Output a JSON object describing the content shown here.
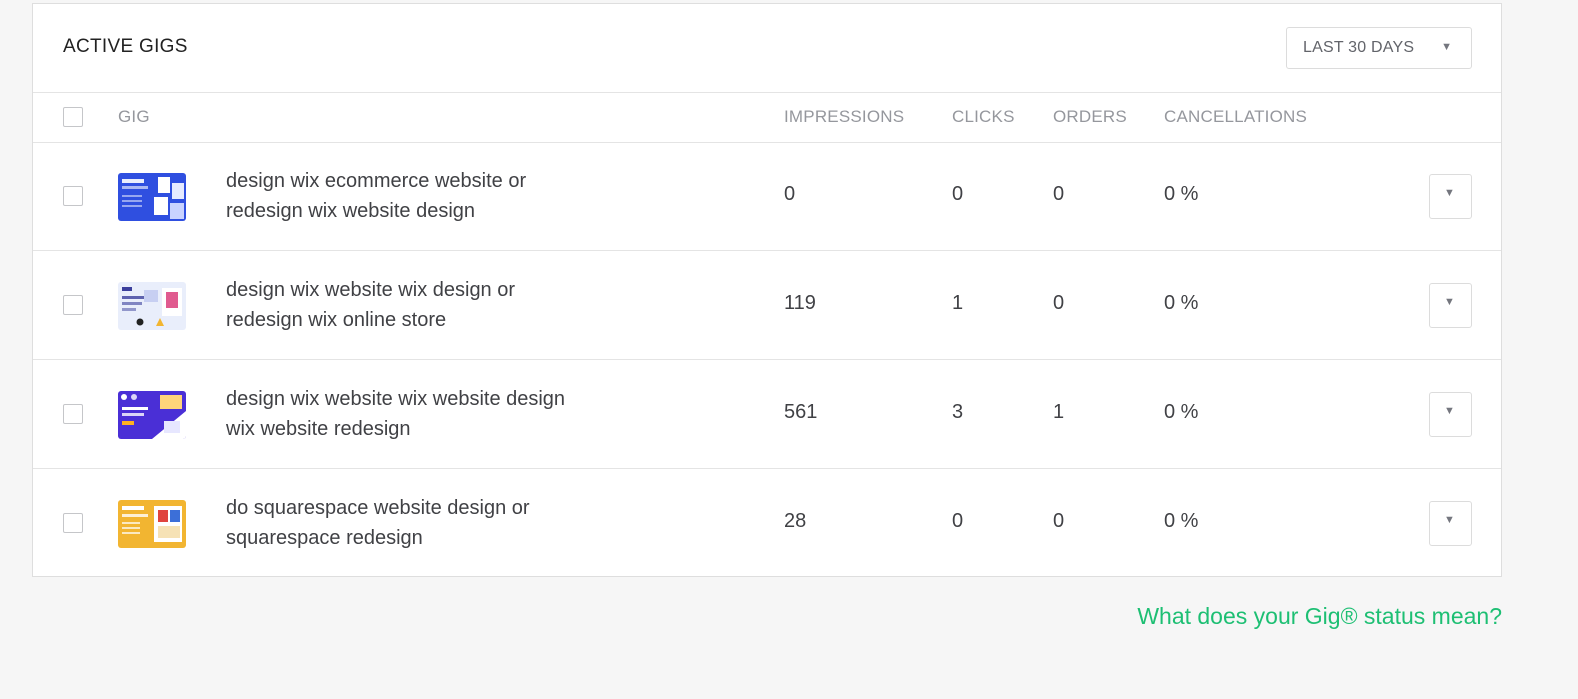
{
  "panel": {
    "title": "ACTIVE GIGS",
    "period": {
      "label": "LAST 30 DAYS",
      "icon": "triangle-down-icon"
    }
  },
  "table": {
    "columns": {
      "gig": "GIG",
      "impressions": "IMPRESSIONS",
      "clicks": "CLICKS",
      "orders": "ORDERS",
      "cancellations": "CANCELLATIONS"
    },
    "rows": [
      {
        "title_line1": "design wix ecommerce website or",
        "title_line2": "redesign wix website design",
        "impressions": "0",
        "clicks": "0",
        "orders": "0",
        "cancellations": "0 %",
        "thumb_color": "#2f4fe0"
      },
      {
        "title_line1": "design wix website wix design or",
        "title_line2": "redesign wix online store",
        "impressions": "119",
        "clicks": "1",
        "orders": "0",
        "cancellations": "0 %",
        "thumb_color": "#e9eefb"
      },
      {
        "title_line1": "design wix website wix website design",
        "title_line2": "wix website redesign",
        "impressions": "561",
        "clicks": "3",
        "orders": "1",
        "cancellations": "0 %",
        "thumb_color": "#4a2fd6"
      },
      {
        "title_line1": "do squarespace website design or",
        "title_line2": "squarespace redesign",
        "impressions": "28",
        "clicks": "0",
        "orders": "0",
        "cancellations": "0 %",
        "thumb_color": "#f2b531"
      }
    ]
  },
  "footer": {
    "status_link": "What does your Gig® status mean?"
  },
  "colors": {
    "accent_green": "#1dbf73",
    "text_dark": "#404145",
    "text_muted": "#95979d"
  }
}
